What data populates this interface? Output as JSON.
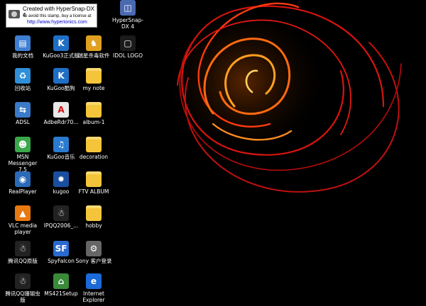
{
  "stamp": {
    "title": "Created with HyperSnap-DX 4",
    "notice": "To avoid this stamp, buy a license at",
    "url": "http://www.hyperionics.com"
  },
  "icons": [
    {
      "label": "我的文档",
      "icon": "my-documents-icon",
      "color": "#3f7fd4",
      "char": "▤"
    },
    {
      "label": "KuGoo3正式版",
      "icon": "kugoo-icon",
      "color": "#1f6fc4",
      "char": "K"
    },
    {
      "label": "瑞星杀毒软件",
      "icon": "rising-antivirus-icon",
      "color": "#e0a020",
      "char": "♞"
    },
    {
      "label": "IDOL LOGO",
      "icon": "idol-logo-icon",
      "color": "#1b1b1b",
      "char": "▢"
    },
    {
      "label": "回收站",
      "icon": "recycle-bin-icon",
      "color": "#2f8fd8",
      "char": "♻"
    },
    {
      "label": "KuGoo酷狗",
      "icon": "kugoo-icon",
      "color": "#1f6fc4",
      "char": "K"
    },
    {
      "label": "my note",
      "icon": "folder-icon",
      "color": "#f4c53a",
      "char": ""
    },
    {
      "label": "ADSL",
      "icon": "network-connection-icon",
      "color": "#3a7ac8",
      "char": "⇆"
    },
    {
      "label": "AdbeRdr70...",
      "icon": "adobe-reader-icon",
      "color": "#e8e8e8",
      "char": "A"
    },
    {
      "label": "album-1",
      "icon": "folder-icon",
      "color": "#f4c53a",
      "char": ""
    },
    {
      "label": "MSN Messenger 7.5",
      "icon": "msn-messenger-icon",
      "color": "#3aa84a",
      "char": "☻"
    },
    {
      "label": "KuGoo音乐",
      "icon": "kugoo-music-icon",
      "color": "#2a7ad0",
      "char": "♫"
    },
    {
      "label": "decoration",
      "icon": "folder-icon",
      "color": "#f4c53a",
      "char": ""
    },
    {
      "label": "RealPlayer",
      "icon": "realplayer-icon",
      "color": "#2a6ab8",
      "char": "◉"
    },
    {
      "label": "kugoo",
      "icon": "kugoo-shortcut-icon",
      "color": "#1a4fa0",
      "char": "✹"
    },
    {
      "label": "FTV ALBUM",
      "icon": "folder-icon",
      "color": "#f4c53a",
      "char": ""
    },
    {
      "label": "VLC media player",
      "icon": "vlc-cone-icon",
      "color": "#e87810",
      "char": "▲"
    },
    {
      "label": "IPQQ2006_...",
      "icon": "qq-penguin-icon",
      "color": "#222222",
      "char": "☃"
    },
    {
      "label": "hobby",
      "icon": "folder-icon",
      "color": "#f4c53a",
      "char": ""
    },
    {
      "label": "腾讯QQ原版",
      "icon": "qq-penguin-icon",
      "color": "#222222",
      "char": "☃"
    },
    {
      "label": "SpyFalcon",
      "icon": "spyfalcon-icon",
      "color": "#2a6ad0",
      "char": "SF"
    },
    {
      "label": "Sony 客户登录",
      "icon": "sony-client-icon",
      "color": "#666666",
      "char": "⚙"
    },
    {
      "label": "腾讯QQ珊瑚虫版",
      "icon": "qq-penguin-icon",
      "color": "#222222",
      "char": "☃"
    },
    {
      "label": "MS421Setup",
      "icon": "setup-icon",
      "color": "#3a8a3a",
      "char": "⌂"
    },
    {
      "label": "Internet Explorer",
      "icon": "internet-explorer-icon",
      "color": "#1a6ad8",
      "char": "e"
    },
    {
      "label": "HyperSnap-DX 4",
      "icon": "hypersnap-icon",
      "color": "#4a6ab0",
      "char": "◫"
    }
  ]
}
